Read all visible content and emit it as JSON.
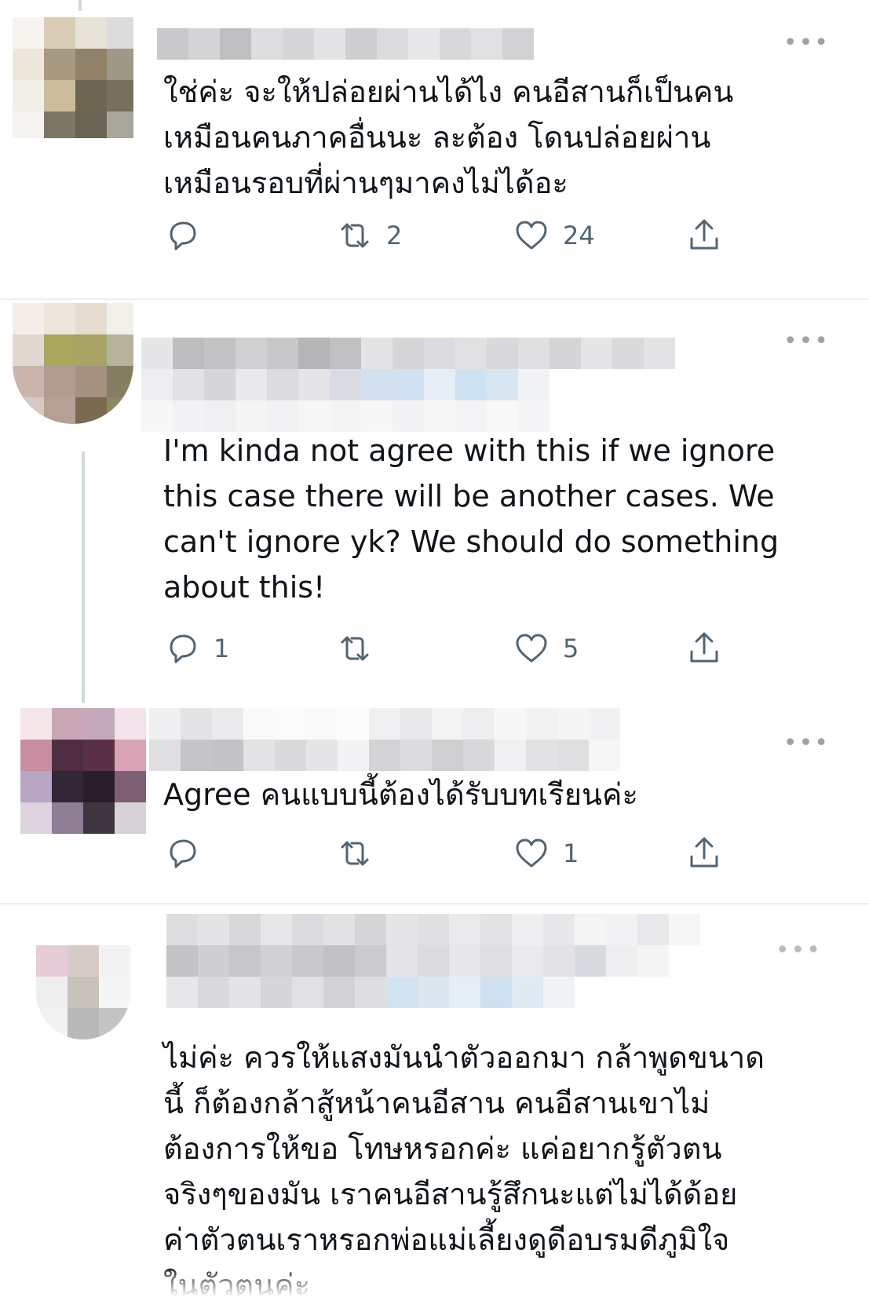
{
  "tweets": [
    {
      "text": "ใช่ค่ะ จะให้ปล่อยผ่านได้ไง คนอีสานก็เป็นคน\nเหมือนคนภาคอื่นนะ ละต้อง โดนปล่อยผ่าน\nเหมือนรอบที่ผ่านๆมาคงไม่ได้อะ",
      "reply_count": "",
      "retweet_count": "2",
      "like_count": "24"
    },
    {
      "text": "I'm kinda not agree with this if we ignore\nthis case there will be another cases. We\ncan't ignore yk? We should do something\nabout this!",
      "reply_count": "1",
      "retweet_count": "",
      "like_count": "5"
    },
    {
      "text": "Agree คนแบบนี้ต้องได้รับบทเรียนค่ะ",
      "reply_count": "",
      "retweet_count": "",
      "like_count": "1"
    },
    {
      "text": "ไม่ค่ะ ควรให้แสงมันนำตัวออกมา กล้าพูดขนาด\nนี้ ก็ต้องกล้าสู้หน้าคนอีสาน คนอีสานเขาไม่\nต้องการให้ขอ โทษหรอกค่ะ แค่อยากรู้ตัวตน\nจริงๆของมัน เราคนอีสานรู้สึกนะแต่ไม่ได้ด้อย\nค่าตัวตนเราหรอกพ่อแม่เลี้ยงดูดีอบรมดีภูมิใจ\nในตัวตนค่ะ"
    }
  ],
  "icons": {
    "reply": "reply-icon",
    "retweet": "retweet-icon",
    "like": "heart-icon",
    "share": "share-icon",
    "more": "more-icon"
  },
  "colors": {
    "icon_gray": "#536471",
    "divider": "#eceff1",
    "thread_line": "#cfd9de",
    "text": "#0f1419"
  }
}
